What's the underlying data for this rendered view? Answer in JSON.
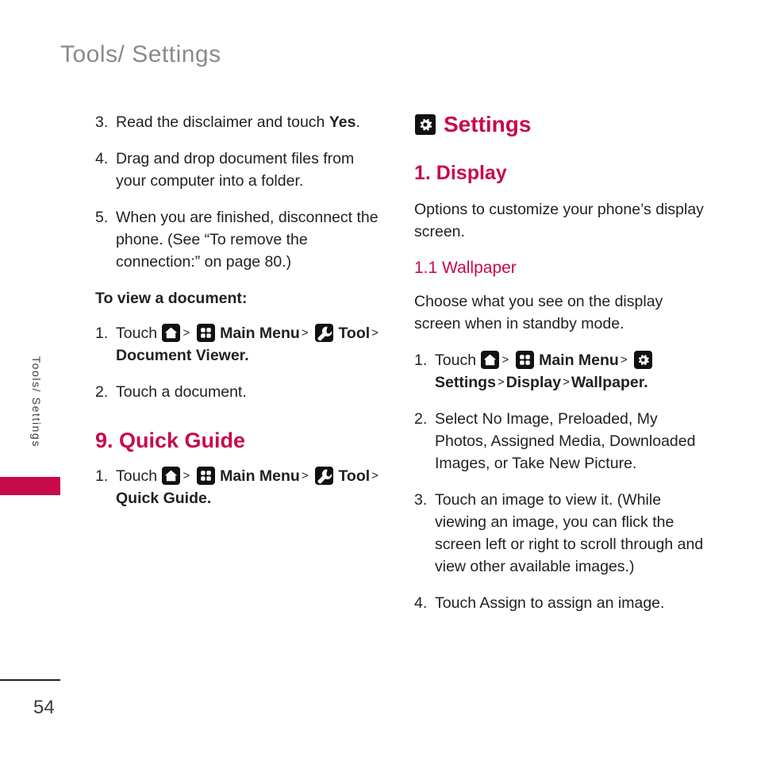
{
  "running_head": "Tools/ Settings",
  "side_tab": {
    "label": "Tools/ Settings"
  },
  "footer": {
    "page_number": "54"
  },
  "colors": {
    "accent_magenta": "#c80a4b",
    "body_text": "#231f20",
    "running_head_gray": "#8a8a8a",
    "icon_background": "#111111"
  },
  "icons": {
    "home": "home-icon",
    "main_menu": "grid-menu-icon",
    "tool": "wrench-icon",
    "settings": "gear-icon"
  },
  "separator": ">",
  "left_column": {
    "steps_continued": [
      {
        "num": "3.",
        "text_before": "Read the disclaimer and touch ",
        "bold": "Yes",
        "text_after": "."
      },
      {
        "num": "4.",
        "text": "Drag and drop document files from your computer into a folder."
      },
      {
        "num": "5.",
        "text": "When you are finished, disconnect the phone. (See “To remove the connection:” on page 80.)"
      }
    ],
    "subhead": "To view a document:",
    "view_steps": [
      {
        "num": "1.",
        "touch_label": "Touch",
        "main_menu_label": "Main Menu",
        "tool_label": "Tool",
        "destination": "Document Viewer."
      },
      {
        "num": "2.",
        "text": "Touch a document."
      }
    ],
    "quick_guide": {
      "heading": "9. Quick Guide",
      "step": {
        "num": "1.",
        "touch_label": "Touch",
        "main_menu_label": "Main Menu",
        "tool_label": "Tool",
        "destination": "Quick Guide."
      }
    }
  },
  "right_column": {
    "chapter_title": "Settings",
    "section_1": {
      "heading": "1. Display",
      "intro": "Options to customize your phone’s display screen.",
      "sub_1_1": {
        "heading": "1.1 Wallpaper",
        "intro": "Choose what you see on the display screen when in standby mode.",
        "steps": [
          {
            "num": "1.",
            "touch_label": "Touch",
            "main_menu_label": "Main Menu",
            "settings_label": "Settings",
            "display_label": "Display",
            "wallpaper_label": "Wallpaper."
          },
          {
            "num": "2.",
            "text": "Select No Image, Preloaded, My Photos, Assigned Media, Downloaded Images, or Take New Picture."
          },
          {
            "num": "3.",
            "text": "Touch an image to view it. (While viewing an image, you can flick the screen left or right to scroll through and view other available images.)"
          },
          {
            "num": "4.",
            "text": "Touch Assign to assign an image."
          }
        ]
      }
    }
  }
}
